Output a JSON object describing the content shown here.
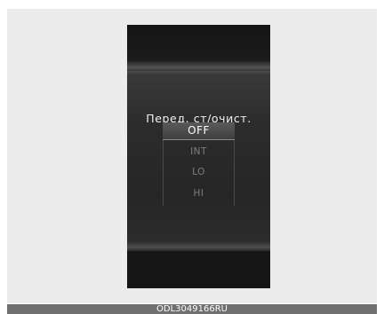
{
  "display": {
    "title": "Перед. ст/очист.",
    "options": [
      {
        "label": "OFF",
        "selected": true
      },
      {
        "label": "INT",
        "selected": false
      },
      {
        "label": "LO",
        "selected": false
      },
      {
        "label": "HI",
        "selected": false
      }
    ]
  },
  "footer": {
    "code": "ODL3049166RU"
  },
  "colors": {
    "screen_background": "#1b1b1b",
    "panel_background": "#2c2c2c",
    "selected_text": "#ffffff",
    "unselected_text": "#7e7e7e"
  }
}
